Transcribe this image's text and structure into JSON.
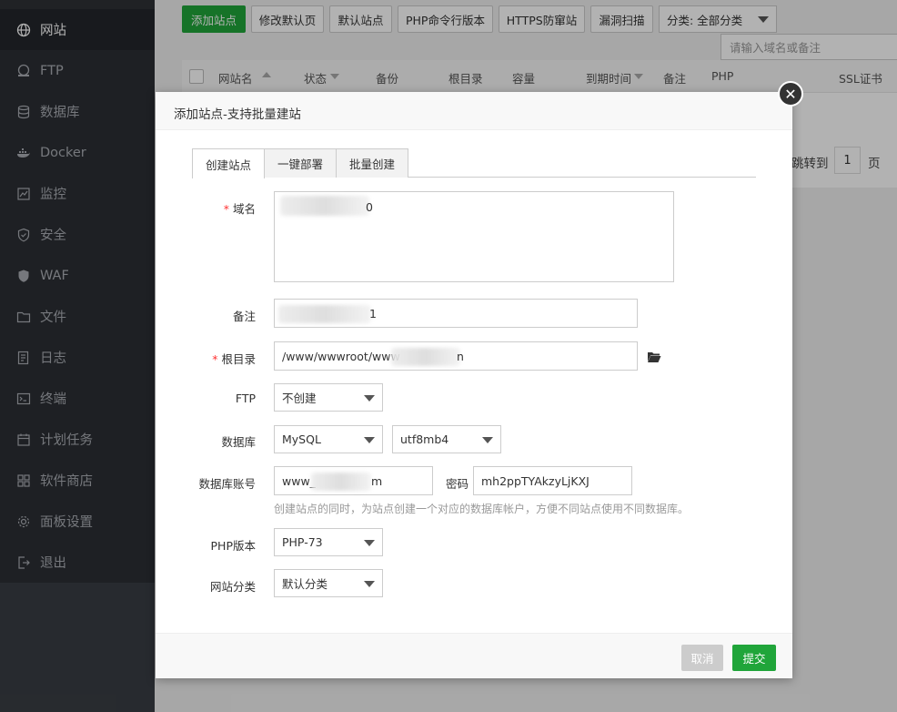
{
  "sidebar": {
    "items": [
      {
        "label": "网站",
        "icon": "globe-icon"
      },
      {
        "label": "FTP",
        "icon": "ftp-icon"
      },
      {
        "label": "数据库",
        "icon": "database-icon"
      },
      {
        "label": "Docker",
        "icon": "docker-icon"
      },
      {
        "label": "监控",
        "icon": "monitor-icon"
      },
      {
        "label": "安全",
        "icon": "shield-icon"
      },
      {
        "label": "WAF",
        "icon": "waf-shield-icon"
      },
      {
        "label": "文件",
        "icon": "folder-icon"
      },
      {
        "label": "日志",
        "icon": "log-icon"
      },
      {
        "label": "终端",
        "icon": "terminal-icon"
      },
      {
        "label": "计划任务",
        "icon": "calendar-icon"
      },
      {
        "label": "软件商店",
        "icon": "apps-grid-icon"
      },
      {
        "label": "面板设置",
        "icon": "gear-icon"
      },
      {
        "label": "退出",
        "icon": "logout-icon"
      }
    ],
    "active_index": 0
  },
  "toolbar": {
    "add_site": "添加站点",
    "modify_default": "修改默认页",
    "default_site": "默认站点",
    "php_cli": "PHP命令行版本",
    "https_protect": "HTTPS防窜站",
    "vuln_scan": "漏洞扫描",
    "category_select": "分类: 全部分类",
    "search_placeholder": "请输入域名或备注"
  },
  "table": {
    "columns": [
      "网站名",
      "状态",
      "备份",
      "根目录",
      "容量",
      "到期时间",
      "备注",
      "PHP",
      "SSL证书"
    ]
  },
  "pager": {
    "jump_to": "跳转到",
    "page_value": "1",
    "page_unit": "页"
  },
  "modal": {
    "title": "添加站点-支持批量建站",
    "tabs": [
      "创建站点",
      "一键部署",
      "批量创建"
    ],
    "active_tab": 0,
    "fields": {
      "domain_label": "域名",
      "domain_value_tail": "0",
      "remark_label": "备注",
      "remark_value_tail": "1",
      "root_label": "根目录",
      "root_value_prefix": "/www/wwwroot/www",
      "root_value_tail": "n",
      "ftp_label": "FTP",
      "ftp_value": "不创建",
      "db_label": "数据库",
      "db_type": "MySQL",
      "db_charset": "utf8mb4",
      "db_user_label": "数据库账号",
      "db_user_prefix": "www_",
      "db_user_tail": "m",
      "password_label": "密码",
      "password_value": "mh2ppTYAkzyLjKXJ",
      "db_hint": "创建站点的同时，为站点创建一个对应的数据库帐户，方便不同站点使用不同数据库。",
      "php_label": "PHP版本",
      "php_value": "PHP-73",
      "category_label": "网站分类",
      "category_value": "默认分类"
    },
    "cancel": "取消",
    "submit": "提交"
  },
  "colors": {
    "primary": "#20a53a",
    "sidebar_bg": "#2c2f34",
    "required": "#ff3333"
  }
}
